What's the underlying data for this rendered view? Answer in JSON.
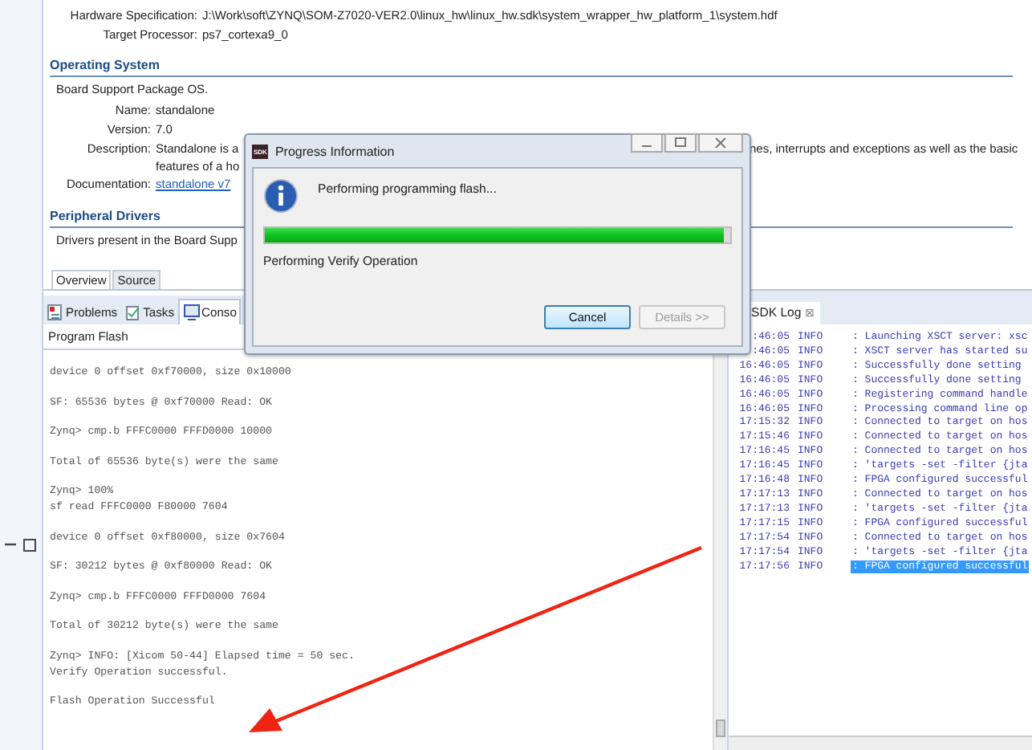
{
  "editor": {
    "header_rows": [
      {
        "label": "Hardware Specification:",
        "value": "J:\\Work\\soft\\ZYNQ\\SOM-Z7020-VER2.0\\linux_hw\\linux_hw.sdk\\system_wrapper_hw_platform_1\\system.hdf"
      },
      {
        "label": "Target Processor:",
        "value": "ps7_cortexa9_0"
      }
    ],
    "operating_system": {
      "heading": "Operating System",
      "intro": "Board Support Package OS.",
      "name_label": "Name:",
      "name": "standalone",
      "version_label": "Version:",
      "version": "7.0",
      "description_label": "Description:",
      "description_left": "Standalone is a",
      "description_right": "nes, interrupts and exceptions as well as the basic",
      "description_line2": "features of a ho",
      "documentation_label": "Documentation:",
      "documentation_link": "standalone v7"
    },
    "peripheral_drivers": {
      "heading": "Peripheral Drivers",
      "intro": "Drivers present in the Board Supp"
    },
    "tabs": [
      {
        "label": "Overview",
        "selected": true
      },
      {
        "label": "Source",
        "selected": false
      }
    ]
  },
  "console": {
    "tabs": [
      {
        "label": "Problems",
        "kind": "problems",
        "selected": false
      },
      {
        "label": "Tasks",
        "kind": "tasks",
        "selected": false
      },
      {
        "label": "Conso",
        "kind": "console",
        "selected": true
      }
    ],
    "title": "Program Flash",
    "groups": [
      [
        "device 0 offset 0xf70000, size 0x10000"
      ],
      [
        "SF: 65536 bytes @ 0xf70000 Read: OK"
      ],
      [
        "Zynq> cmp.b FFFC0000 FFFD0000 10000"
      ],
      [
        "Total of 65536 byte(s) were the same"
      ],
      [
        "Zynq> 100%",
        "sf read FFFC0000 F80000 7604"
      ],
      [
        "device 0 offset 0xf80000, size 0x7604"
      ],
      [
        "SF: 30212 bytes @ 0xf80000 Read: OK"
      ],
      [
        "Zynq> cmp.b FFFC0000 FFFD0000 7604"
      ],
      [
        "Total of 30212 byte(s) were the same"
      ],
      [
        "Zynq> INFO: [Xicom 50-44] Elapsed time = 50 sec.",
        "Verify Operation successful."
      ],
      [
        "Flash Operation Successful"
      ]
    ]
  },
  "sdk_log": {
    "tab": "SDK Log",
    "close": "⊠",
    "lines": [
      {
        "time": ":46:05",
        "level": "INFO",
        "message": ": Launching XSCT server: xsc",
        "selected": false
      },
      {
        "time": ":46:05",
        "level": "INFO",
        "message": ": XSCT server has started su",
        "selected": false
      },
      {
        "time": "16:46:05",
        "level": "INFO",
        "message": ": Successfully done setting",
        "selected": false
      },
      {
        "time": "16:46:05",
        "level": "INFO",
        "message": ": Successfully done setting",
        "selected": false
      },
      {
        "time": "16:46:05",
        "level": "INFO",
        "message": ": Registering command handle",
        "selected": false
      },
      {
        "time": "16:46:05",
        "level": "INFO",
        "message": ": Processing command line op",
        "selected": false
      },
      {
        "time": "17:15:32",
        "level": "INFO",
        "message": ": Connected to target on hos",
        "selected": false
      },
      {
        "time": "17:15:46",
        "level": "INFO",
        "message": ": Connected to target on hos",
        "selected": false
      },
      {
        "time": "17:16:45",
        "level": "INFO",
        "message": ": Connected to target on hos",
        "selected": false
      },
      {
        "time": "17:16:45",
        "level": "INFO",
        "message": ": 'targets -set -filter {jta",
        "selected": false
      },
      {
        "time": "17:16:48",
        "level": "INFO",
        "message": ": FPGA configured successful",
        "selected": false
      },
      {
        "time": "17:17:13",
        "level": "INFO",
        "message": ": Connected to target on hos",
        "selected": false
      },
      {
        "time": "17:17:13",
        "level": "INFO",
        "message": ": 'targets -set -filter {jta",
        "selected": false
      },
      {
        "time": "17:17:15",
        "level": "INFO",
        "message": ": FPGA configured successful",
        "selected": false
      },
      {
        "time": "17:17:54",
        "level": "INFO",
        "message": ": Connected to target on hos",
        "selected": false
      },
      {
        "time": "17:17:54",
        "level": "INFO",
        "message": ": 'targets -set -filter {jta",
        "selected": false
      },
      {
        "time": "17:17:56",
        "level": "INFO",
        "message": ": FPGA configured successful",
        "selected": true
      }
    ]
  },
  "dialog": {
    "app_badge": "SDK",
    "title": "Progress Information",
    "message": "Performing programming flash...",
    "progress": {
      "level": 0.985
    },
    "status": "Performing Verify Operation",
    "buttons": [
      {
        "label": "Cancel",
        "disabled": false,
        "default": true
      },
      {
        "label": "Details >>",
        "disabled": true,
        "default": false
      }
    ]
  }
}
